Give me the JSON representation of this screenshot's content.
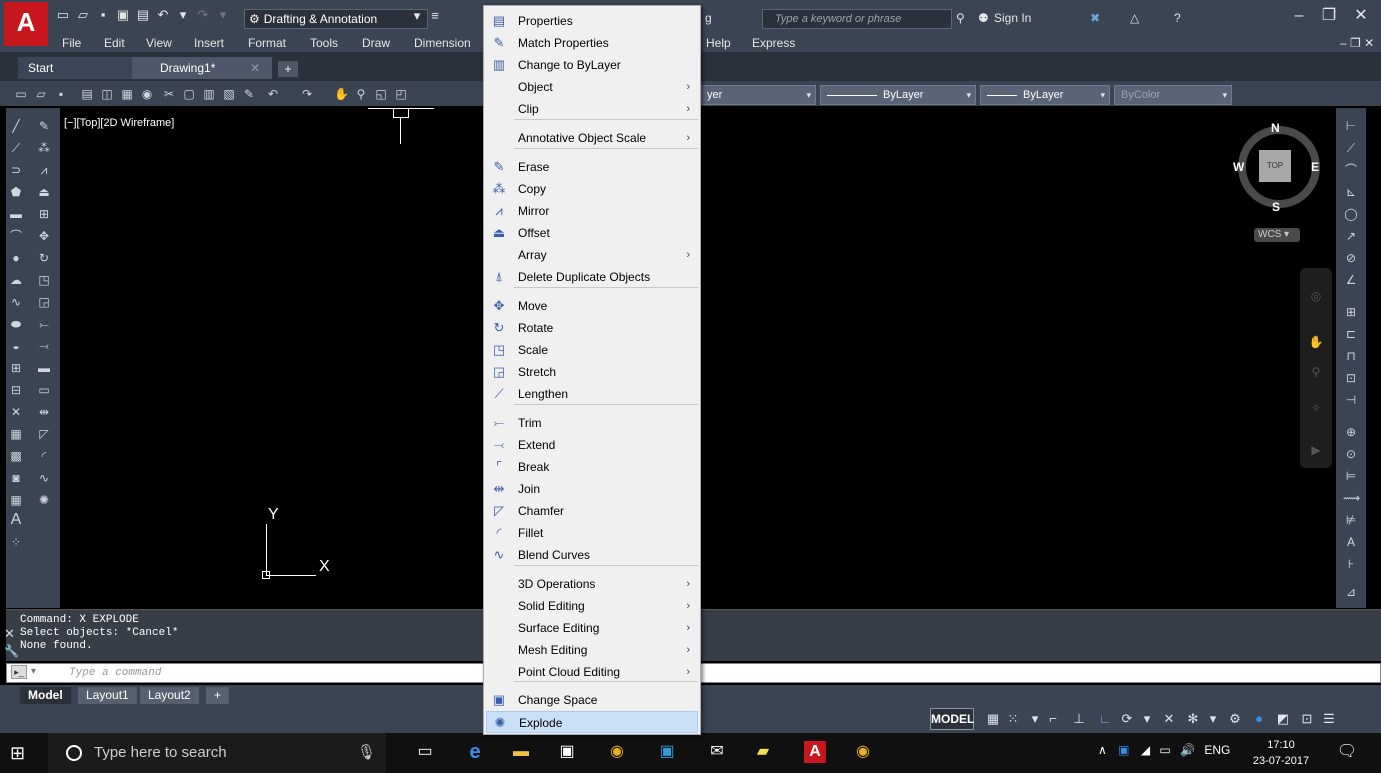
{
  "app": {
    "logo_letter": "A",
    "workspace": "Drafting & Annotation",
    "title_partial": "g",
    "search_placeholder": "Type a keyword or phrase",
    "sign_in": "Sign In"
  },
  "menubar": {
    "items": [
      "File",
      "Edit",
      "View",
      "Insert",
      "Format",
      "Tools",
      "Draw",
      "Dimension",
      "Help",
      "Express"
    ]
  },
  "doctabs": {
    "start": "Start",
    "drawing": "Drawing1*",
    "add": "+"
  },
  "toolbar": {
    "layer_partial": "yer",
    "linetype": "ByLayer",
    "lineweight": "ByLayer",
    "plotstyle": "ByColor"
  },
  "canvas": {
    "view_label": "[−][Top][2D Wireframe]",
    "ucs_x": "X",
    "ucs_y": "Y"
  },
  "viewcube": {
    "north": "N",
    "south": "S",
    "east": "E",
    "west": "W",
    "top": "TOP",
    "wcs": "WCS"
  },
  "command": {
    "history": [
      "Command: X EXPLODE",
      "Select objects: *Cancel*",
      "None found."
    ],
    "placeholder": "Type a command"
  },
  "layouttabs": {
    "model": "Model",
    "layout1": "Layout1",
    "layout2": "Layout2",
    "add": "+"
  },
  "status": {
    "model": "MODEL"
  },
  "context_menu": {
    "items": [
      {
        "label": "Properties",
        "icon": "properties-icon",
        "submenu": false
      },
      {
        "label": "Match Properties",
        "icon": "match-properties-icon",
        "submenu": false
      },
      {
        "label": "Change to ByLayer",
        "icon": "change-bylayer-icon",
        "submenu": false
      },
      {
        "label": "Object",
        "icon": "",
        "submenu": true
      },
      {
        "label": "Clip",
        "icon": "",
        "submenu": true
      },
      {
        "label": "Annotative Object Scale",
        "icon": "",
        "submenu": true
      },
      {
        "label": "Erase",
        "icon": "erase-icon",
        "submenu": false
      },
      {
        "label": "Copy",
        "icon": "copy-icon",
        "submenu": false
      },
      {
        "label": "Mirror",
        "icon": "mirror-icon",
        "submenu": false
      },
      {
        "label": "Offset",
        "icon": "offset-icon",
        "submenu": false
      },
      {
        "label": "Array",
        "icon": "",
        "submenu": true
      },
      {
        "label": "Delete Duplicate Objects",
        "icon": "delete-duplicates-icon",
        "submenu": false
      },
      {
        "label": "Move",
        "icon": "move-icon",
        "submenu": false
      },
      {
        "label": "Rotate",
        "icon": "rotate-icon",
        "submenu": false
      },
      {
        "label": "Scale",
        "icon": "scale-icon",
        "submenu": false
      },
      {
        "label": "Stretch",
        "icon": "stretch-icon",
        "submenu": false
      },
      {
        "label": "Lengthen",
        "icon": "lengthen-icon",
        "submenu": false
      },
      {
        "label": "Trim",
        "icon": "trim-icon",
        "submenu": false
      },
      {
        "label": "Extend",
        "icon": "extend-icon",
        "submenu": false
      },
      {
        "label": "Break",
        "icon": "break-icon",
        "submenu": false
      },
      {
        "label": "Join",
        "icon": "join-icon",
        "submenu": false
      },
      {
        "label": "Chamfer",
        "icon": "chamfer-icon",
        "submenu": false
      },
      {
        "label": "Fillet",
        "icon": "fillet-icon",
        "submenu": false
      },
      {
        "label": "Blend Curves",
        "icon": "blend-curves-icon",
        "submenu": false
      },
      {
        "label": "3D Operations",
        "icon": "",
        "submenu": true
      },
      {
        "label": "Solid Editing",
        "icon": "",
        "submenu": true
      },
      {
        "label": "Surface Editing",
        "icon": "",
        "submenu": true
      },
      {
        "label": "Mesh Editing",
        "icon": "",
        "submenu": true
      },
      {
        "label": "Point Cloud Editing",
        "icon": "",
        "submenu": true
      },
      {
        "label": "Change Space",
        "icon": "change-space-icon",
        "submenu": false
      },
      {
        "label": "Explode",
        "icon": "explode-icon",
        "submenu": false,
        "highlighted": true
      }
    ]
  },
  "taskbar": {
    "search_placeholder": "Type here to search",
    "language": "ENG",
    "time": "17:10",
    "date": "23-07-2017"
  },
  "colors": {
    "chrome": "#3b4453",
    "canvas": "#000000",
    "brand_red": "#c8161d",
    "menu_bg": "#f0f0f0",
    "highlight": "#c9e0f7"
  }
}
